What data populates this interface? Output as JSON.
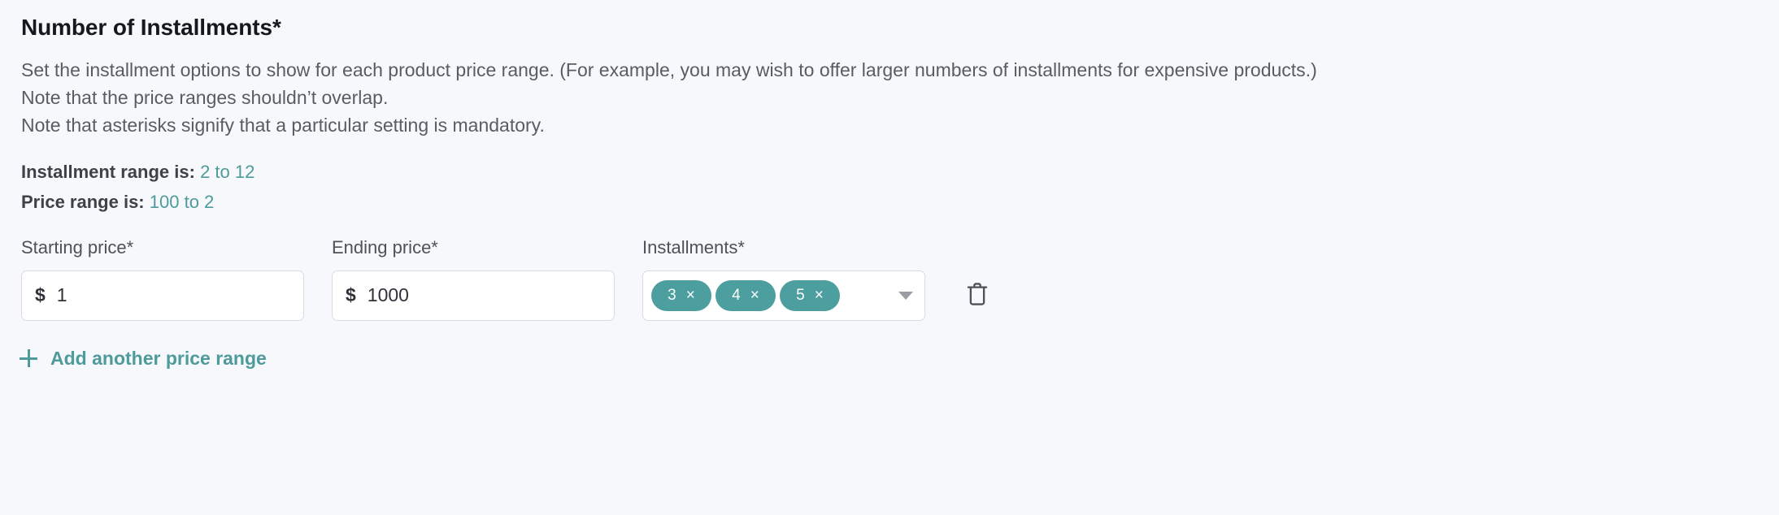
{
  "section": {
    "title": "Number of Installments*",
    "description_lines": [
      "Set the installment options to show for each product price range. (For example, you may wish to offer larger numbers of installments for expensive products.)",
      "Note that the price ranges shouldn’t overlap.",
      "Note that asterisks signify that a particular setting is mandatory."
    ]
  },
  "ranges_info": [
    {
      "label": "Installment range is:",
      "value": "2 to 12"
    },
    {
      "label": "Price range is:",
      "value": "100 to 2"
    }
  ],
  "form": {
    "starting_price": {
      "label": "Starting price*",
      "currency": "$",
      "value": "1",
      "placeholder": ""
    },
    "ending_price": {
      "label": "Ending price*",
      "currency": "$",
      "value": "1000",
      "placeholder": ""
    },
    "installments": {
      "label": "Installments*",
      "tags": [
        {
          "value": "3",
          "remove": "×"
        },
        {
          "value": "4",
          "remove": "×"
        },
        {
          "value": "5",
          "remove": "×"
        }
      ],
      "caret_icon": "chevron-down-icon"
    },
    "delete_icon": "trash-icon"
  },
  "add_link": {
    "icon": "plus-icon",
    "label": "Add another price range"
  },
  "colors": {
    "accent": "#4d9b9b",
    "tag_bg": "#4d9e9e",
    "page_bg": "#f7f8fc",
    "text_primary": "#16181d",
    "text_secondary": "#585c63",
    "border": "#d9dbe0"
  }
}
